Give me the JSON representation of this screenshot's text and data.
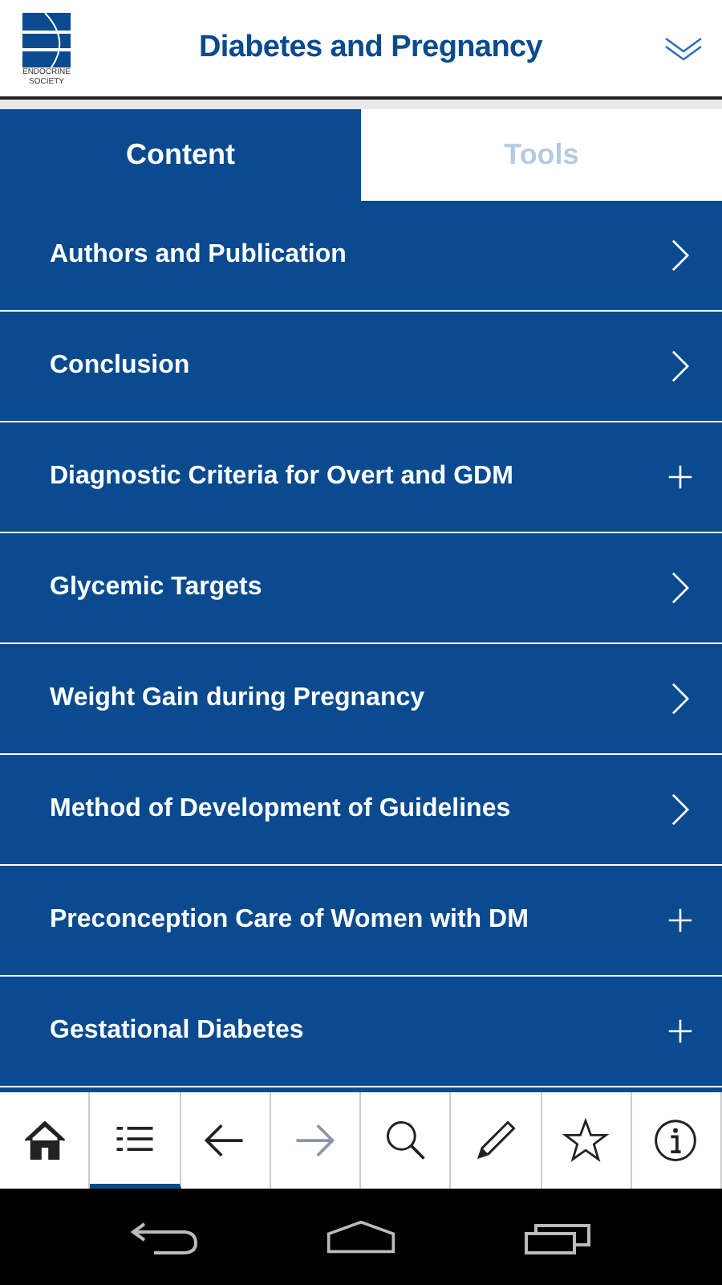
{
  "header": {
    "logo_text": [
      "ENDOCRINE",
      "SOCIETY"
    ],
    "title": "Diabetes and Pregnancy"
  },
  "tabs": [
    {
      "label": "Content",
      "selected": true
    },
    {
      "label": "Tools",
      "selected": false
    }
  ],
  "items": [
    {
      "label": "Authors and Publication",
      "kind": "chevron"
    },
    {
      "label": "Conclusion",
      "kind": "chevron"
    },
    {
      "label": "Diagnostic Criteria for Overt and GDM",
      "kind": "plus"
    },
    {
      "label": "Glycemic Targets",
      "kind": "chevron"
    },
    {
      "label": "Weight Gain during Pregnancy",
      "kind": "chevron"
    },
    {
      "label": "Method of Development of Guidelines",
      "kind": "chevron"
    },
    {
      "label": "Preconception Care of Women with DM",
      "kind": "plus"
    },
    {
      "label": "Gestational Diabetes",
      "kind": "plus"
    }
  ],
  "toolbar": [
    {
      "kind": "home",
      "selected": false,
      "disabled": false
    },
    {
      "kind": "list",
      "selected": true,
      "disabled": false
    },
    {
      "kind": "back",
      "selected": false,
      "disabled": false
    },
    {
      "kind": "forward",
      "selected": false,
      "disabled": true
    },
    {
      "kind": "search",
      "selected": false,
      "disabled": false
    },
    {
      "kind": "pencil",
      "selected": false,
      "disabled": false
    },
    {
      "kind": "star",
      "selected": false,
      "disabled": false
    },
    {
      "kind": "info",
      "selected": false,
      "disabled": false
    }
  ]
}
